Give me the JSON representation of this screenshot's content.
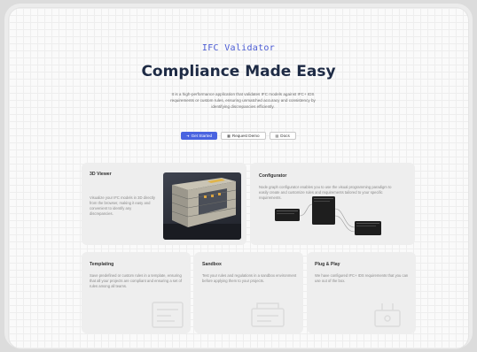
{
  "hero": {
    "brand": "IFC Validator",
    "headline": "Compliance Made Easy",
    "description": "It is a high-performance application that validates IFC models against IFC+ IDS requirements or custom rules, ensuring unmatched accuracy and consistency by identifying discrepancies efficiently.",
    "buttons": [
      {
        "label": "Get Started",
        "icon": "arrow-icon"
      },
      {
        "label": "Request Demo",
        "icon": "calendar-icon"
      },
      {
        "label": "Docs",
        "icon": "book-icon"
      }
    ]
  },
  "cards": {
    "viewer": {
      "title": "3D Viewer",
      "text": "Visualize your IFC models in 3D directly from the browser, making it easy and convenient to identify any discrepancies."
    },
    "configurator": {
      "title": "Configurator",
      "text": "Node graph configurator enables you to use the visual programming paradigm to easily create and customize rules and requirements tailored to your specific requirements."
    },
    "templating": {
      "title": "Templating",
      "text": "Save predefined or custom rules in a template, ensuring that all your projects are compliant and ensuring a set of rules among all teams."
    },
    "sandbox": {
      "title": "Sandbox",
      "text": "Test your rules and regulations in a sandbox environment before applying them to your projects."
    },
    "plugplay": {
      "title": "Plug & Play",
      "text": "We have configured IFC+ IDS requirements that you can use out of the box."
    }
  },
  "colors": {
    "accent": "#4a64e0",
    "brand": "#4a5bd4",
    "heading": "#1e2b45",
    "card_bg": "#eeeeee",
    "node": "#1e1e1e"
  }
}
